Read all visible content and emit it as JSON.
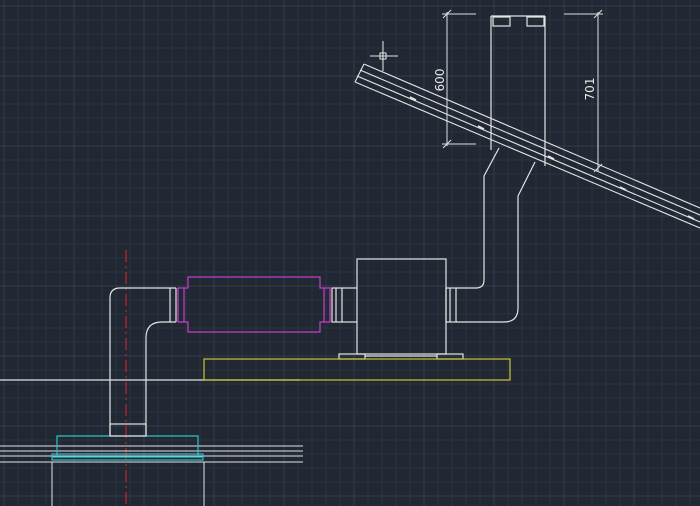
{
  "viewport": {
    "background": "#212833",
    "grid_minor": "#2b3340",
    "grid_major": "#343d4b"
  },
  "colors": {
    "geometry": "#e4e4e4",
    "centerline": "#c8232c",
    "flex_duct": "#c43fc7",
    "equipment_base": "#c9c62b",
    "flange": "#2ec3cc",
    "dimension": "#e0e0e0"
  },
  "cursor": {
    "icon": "crosshair-pickbox-icon"
  },
  "dimensions": {
    "roof_height_dim": "600",
    "flue_height_dim": "701"
  }
}
